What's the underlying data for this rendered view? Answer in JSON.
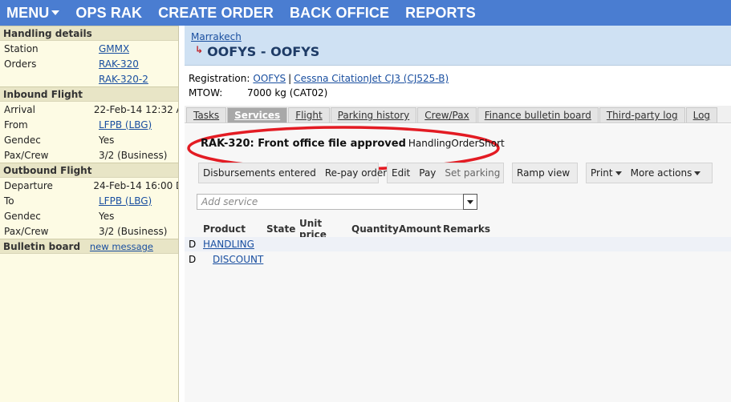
{
  "topnav": [
    {
      "label": "MENU"
    },
    {
      "label": "OPS RAK"
    },
    {
      "label": "CREATE ORDER"
    },
    {
      "label": "BACK OFFICE"
    },
    {
      "label": "REPORTS"
    }
  ],
  "sidebar": {
    "handling": {
      "heading": "Handling details",
      "station_label": "Station",
      "station_value": "GMMX",
      "orders_label": "Orders",
      "orders": [
        "RAK-320",
        "RAK-320-2"
      ]
    },
    "inbound": {
      "heading": "Inbound Flight",
      "rows": [
        {
          "label": "Arrival",
          "value": "22-Feb-14 12:32 A"
        },
        {
          "label": "From",
          "value": "LFPB (LBG)"
        },
        {
          "label": "Gendec",
          "value": "Yes"
        },
        {
          "label": "Pax/Crew",
          "value": "3/2 (Business)"
        }
      ]
    },
    "outbound": {
      "heading": "Outbound Flight",
      "rows": [
        {
          "label": "Departure",
          "value": "24-Feb-14 16:00 D"
        },
        {
          "label": "To",
          "value": "LFPB (LBG)"
        },
        {
          "label": "Gendec",
          "value": "Yes"
        },
        {
          "label": "Pax/Crew",
          "value": "3/2 (Business)"
        }
      ]
    },
    "bulletin": {
      "heading": "Bulletin board",
      "new_message": "new message"
    }
  },
  "header": {
    "city": "Marrakech",
    "return_glyph": "↳",
    "title": "OOFYS - OOFYS"
  },
  "registration": {
    "label": "Registration:",
    "reg": "OOFYS",
    "sep": "|",
    "aircraft": "Cessna CitationJet CJ3 (CJ525-B)",
    "mtow_label": "MTOW:",
    "mtow_value": "7000 kg (CAT02)"
  },
  "tabs": [
    "Tasks",
    "Services",
    "Flight",
    "Parking history",
    "Crew/Pax",
    "Finance bulletin board",
    "Third-party log",
    "Log"
  ],
  "active_tab": "Services",
  "status": {
    "text": "RAK-320: Front office file approved",
    "short": "HandlingOrderShort"
  },
  "actions": {
    "disbursements": "Disbursements entered",
    "repay": "Re-pay order",
    "edit": "Edit",
    "pay": "Pay",
    "set_parking": "Set parking",
    "ramp_view": "Ramp view",
    "print": "Print",
    "more_actions": "More actions"
  },
  "add_service": {
    "placeholder": "Add service"
  },
  "table": {
    "columns": [
      "Product",
      "State",
      "Unit price",
      "Quantity",
      "Amount",
      "Remarks"
    ],
    "rows": [
      {
        "flag": "D",
        "product": "HANDLING"
      },
      {
        "flag": "D",
        "product": "DISCOUNT"
      }
    ]
  },
  "colors": {
    "topbar": "#4a7dd1",
    "sidebar": "#fdfbe4",
    "header": "#cfe1f3",
    "annotation": "#e31b23"
  }
}
